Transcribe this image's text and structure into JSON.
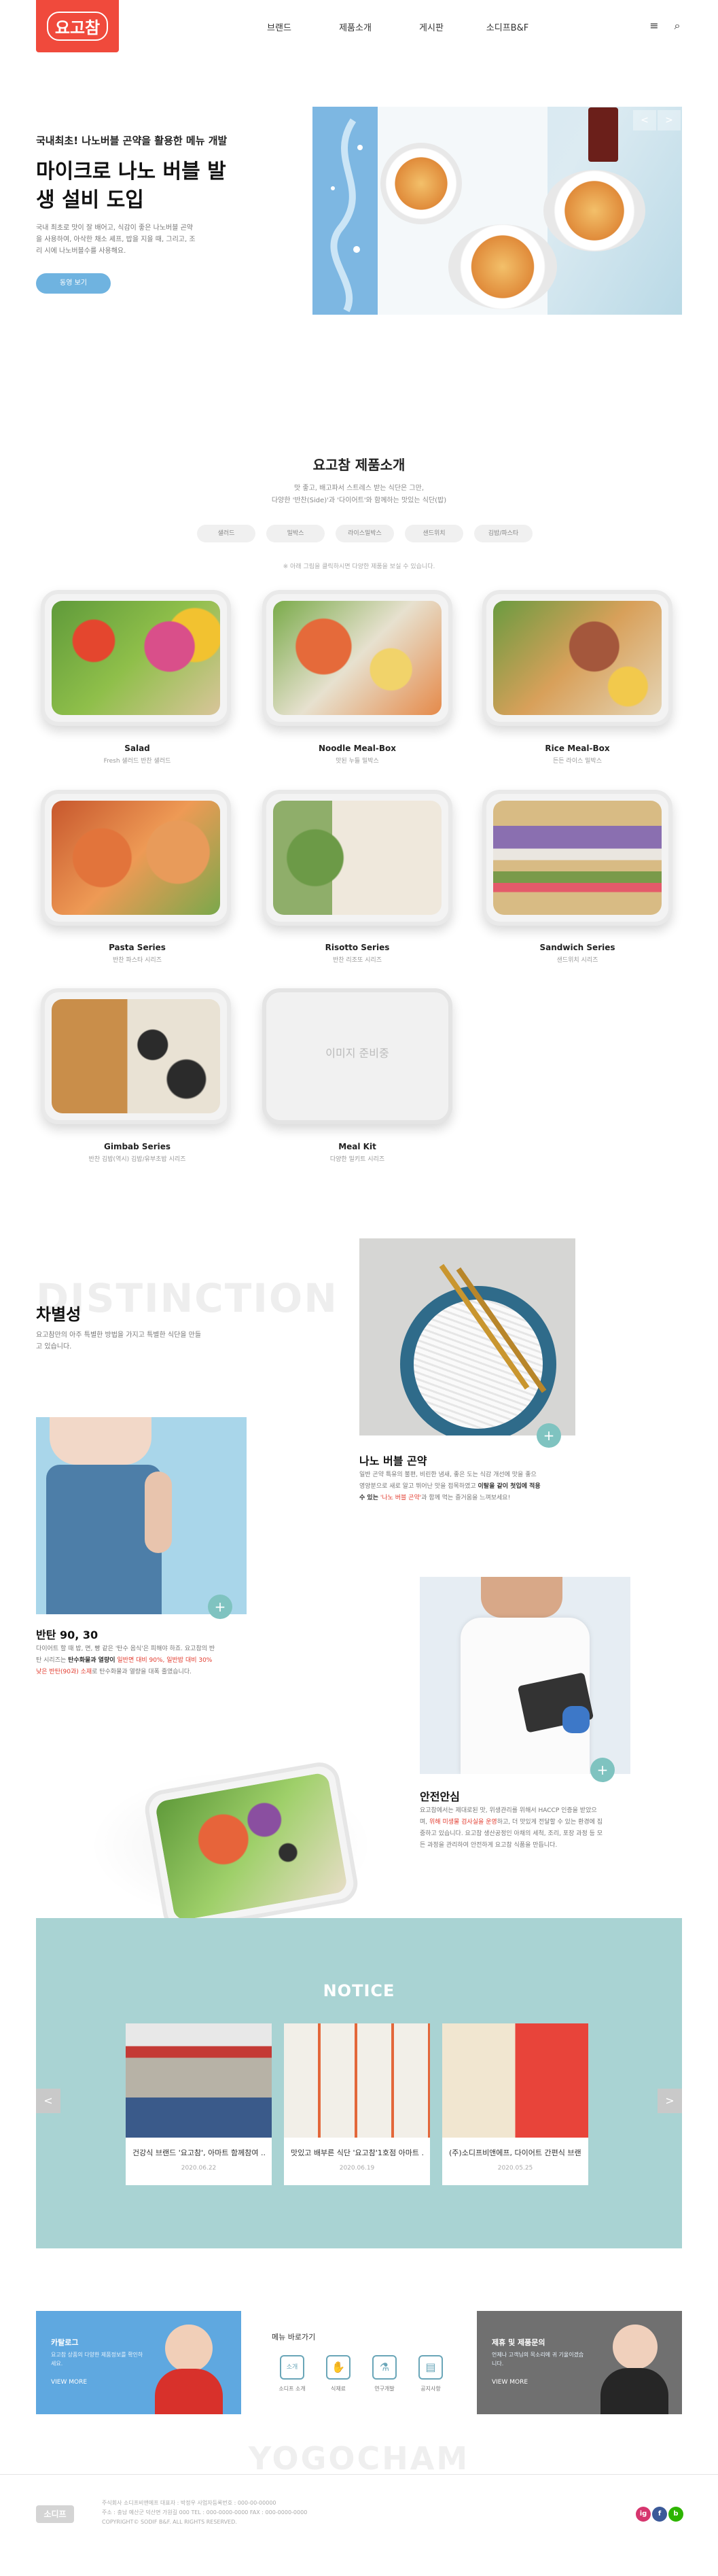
{
  "header": {
    "logo_text": "요고참",
    "nav": [
      "브랜드",
      "제품소개",
      "게시판",
      "소디프B&F"
    ],
    "menu_icon": "≡",
    "search_icon": "⌕"
  },
  "hero": {
    "kicker": "국내최초! 나노버블 곤약을 활용한 메뉴 개발",
    "title": "마이크로 나노 버블 발생 설비 도입",
    "desc": "국내 최초로 맛이 잘 배어고, 식감이 좋은 나노버블 곤약을 사용하여, 아삭한 채소 셰프, 밥을 지을 때, 그리고, 조리 시에 나노버블수를 사용해요.",
    "button": "동영 보기",
    "prev": "<",
    "next": ">"
  },
  "products": {
    "title": "요고참 제품소개",
    "subtitle_lines": [
      "맛 좋고, 배고파서 스트레스 받는 식단은 그만,",
      "다양한 '반찬(Side)'과 '다이어트'와 함께하는 맛있는 식단(밥)"
    ],
    "chips": [
      "샐러드",
      "밀박스",
      "라이스밀박스",
      "샌드위치",
      "김밥/파스타"
    ],
    "note": "※ 아래 그림을 클릭하시면 다양한 제품을 보실 수 있습니다.",
    "items": [
      {
        "name": "Salad",
        "desc": "Fresh 샐러드 반찬 샐러드"
      },
      {
        "name": "Noodle Meal-Box",
        "desc": "맛된 누들 밀박스"
      },
      {
        "name": "Rice Meal-Box",
        "desc": "든든 라이스 밀박스"
      },
      {
        "name": "Pasta Series",
        "desc": "반찬 파스타 시리즈"
      },
      {
        "name": "Risotto Series",
        "desc": "반찬 리조또 시리즈"
      },
      {
        "name": "Sandwich Series",
        "desc": "샌드위치 시리즈"
      },
      {
        "name": "Gimbab Series",
        "desc": "반찬 김밥(역시) 김밥/유부초밥 시리즈"
      },
      {
        "name": "Meal Kit",
        "desc": "다양한 밀키트 시리즈"
      }
    ],
    "placeholder": "이미지 준비중"
  },
  "distinction": {
    "bg_text": "DISTINCTION",
    "title": "차별성",
    "desc": "요고참만의 아주 특별한 방법을 가지고 특별한 식단을 만들고 있습니다.",
    "features": [
      {
        "title": "나노 버블 곤약",
        "desc_pre": "일반 곤약 특유의 불편, 비린한 냄새, 좋은 도는 식감 개선에 맛을 좋으 영양분으로 새로 알고 뛰어난 맛을 접목하였고",
        "desc_bold": "이탈을 같이 첫입에 적용 수 있는",
        "desc_red": "'나노 버블 곤약'",
        "desc_post": "과 함께 먹는 즐거움을 느껴보세요!"
      },
      {
        "title": "반탄 90, 30",
        "desc_pre": "다이어트 할 때 밥, 면, 빵 같은 '탄수 음식'은 피해야 하죠. 요고참의 반탄 시리즈는",
        "desc_bold": "탄수화물과 열량이",
        "desc_red": "일반면 대비 90%, 일반밥 대비 30% 낮은 반탄(90과) 소재",
        "desc_post": "로 탄수화물과 열량을 대폭 줄였습니다."
      },
      {
        "title": "안전안심",
        "desc_pre": "요고참에서는 제대로된 맛, 위생관리를 위해서 HACCP 인증을 받았으며,",
        "desc_bold": "",
        "desc_red": "위해 미생물 검사실을 운영",
        "desc_post": "하고, 더 맛있게 전달할 수 있는 환경에 집중하고 있습니다. 요고참 생산공정인 아채의 세척, 조리, 포장 과정 등 모든 과정을 관리하여 안전하게 요고참 식품을 만듭니다."
      }
    ]
  },
  "notice": {
    "title": "NOTICE",
    "prev": "<",
    "next": ">",
    "cards": [
      {
        "title": "건강식 브랜드 '요고참', 아마트 함께참여 ...",
        "date": "2020.06.22"
      },
      {
        "title": "맛있고 배부른 식단 '요고참'1호점 아마트 ...",
        "date": "2020.06.19"
      },
      {
        "title": "(주)소디프비앤에프, 다이어트 간편식 브랜...",
        "date": "2020.05.25"
      }
    ]
  },
  "banners": {
    "left": {
      "title": "카탈로그",
      "desc": "요고참 상품의 다양한 제품정보를 확인하세요.",
      "more": "VIEW MORE"
    },
    "quick_title": "메뉴 바로가기",
    "quick": [
      {
        "icon": "소개",
        "label": "소디프 소개"
      },
      {
        "icon": "✋",
        "label": "식재료"
      },
      {
        "icon": "⚗",
        "label": "연구개발"
      },
      {
        "icon": "▤",
        "label": "공지사항"
      }
    ],
    "right": {
      "title": "제휴 및 제품문의",
      "desc": "언제나 고객님의 목소리에 귀 기울이겠습니다.",
      "more": "VIEW MORE"
    }
  },
  "footer": {
    "bg_text": "YOGOCHAM",
    "logo_text": "소디프",
    "info_lines": [
      "주식회사 소디프비앤에프   대표자 : 박정우   사업자등록번호 : 000-00-00000",
      "주소 : 충남 예산군 덕산면 가원길 000   TEL : 000-0000-0000   FAX : 000-0000-0000",
      "COPYRIGHT© SODIF B&F. ALL RIGHTS RESERVED."
    ],
    "sns": [
      "ig",
      "f",
      "b"
    ]
  },
  "colors": {
    "accent_red": "#f04a3c",
    "teal": "#a9d3d3",
    "blue": "#5fa8e0"
  }
}
